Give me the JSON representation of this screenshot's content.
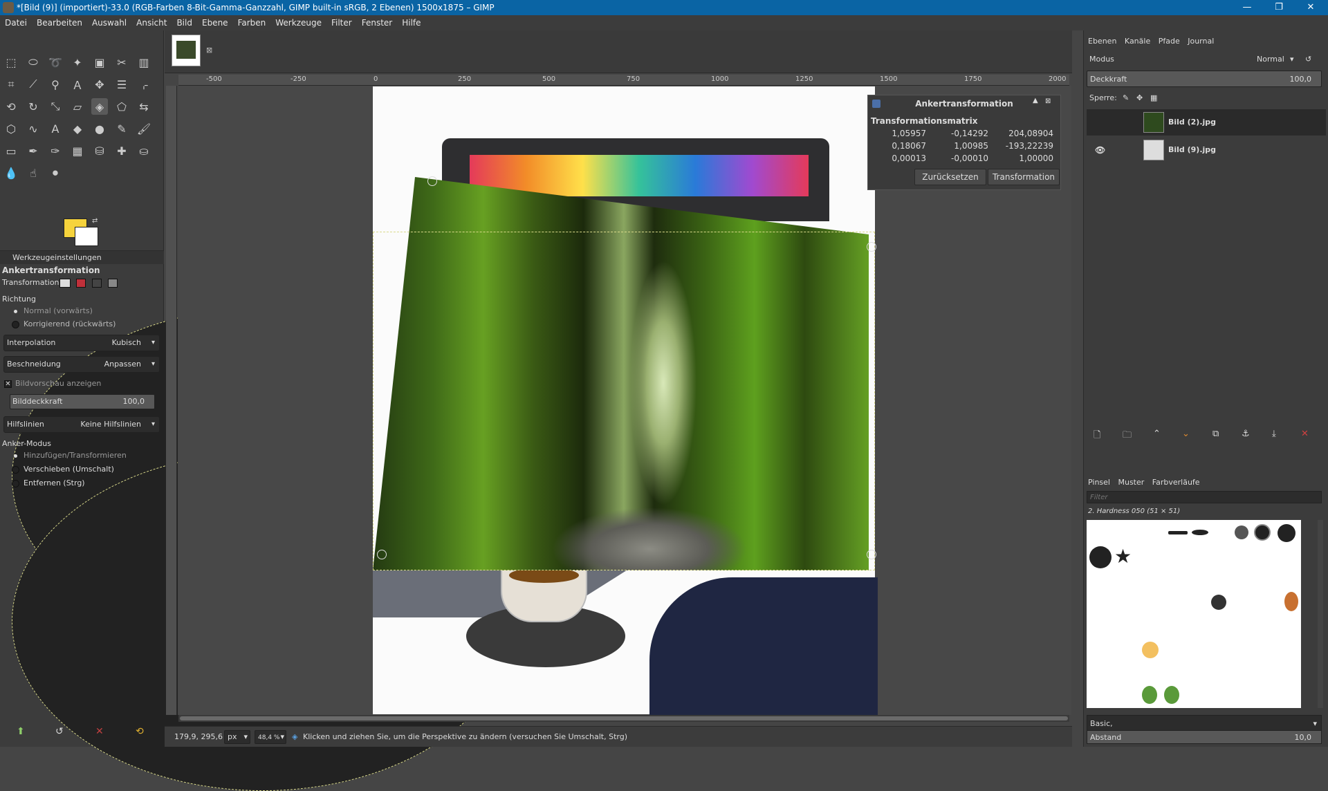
{
  "window": {
    "title": "*[Bild (9)] (importiert)-33.0 (RGB-Farben 8-Bit-Gamma-Ganzzahl, GIMP built-in sRGB, 2 Ebenen) 1500x1875 – GIMP",
    "minimize": "—",
    "maximize": "❐",
    "close": "✕"
  },
  "menu": [
    "Datei",
    "Bearbeiten",
    "Auswahl",
    "Ansicht",
    "Bild",
    "Ebene",
    "Farben",
    "Werkzeuge",
    "Filter",
    "Fenster",
    "Hilfe"
  ],
  "tool_options": {
    "dock_title": "Werkzeugeinstellungen",
    "tool_name": "Ankertransformation",
    "transformation_label": "Transformation:",
    "direction_label": "Richtung",
    "direction_normal": "Normal (vorwärts)",
    "direction_corrective": "Korrigierend (rückwärts)",
    "interpolation_label": "Interpolation",
    "interpolation_value": "Kubisch",
    "clipping_label": "Beschneidung",
    "clipping_value": "Anpassen",
    "preview_label": "Bildvorschau anzeigen",
    "opacity_label": "Bilddeckkraft",
    "opacity_value": "100,0",
    "guides_label": "Hilfslinien",
    "guides_value": "Keine Hilfslinien",
    "anchor_mode_label": "Anker-Modus",
    "anchor_add": "Hinzufügen/Transformieren",
    "anchor_move": "Verschieben (Umschalt)",
    "anchor_remove": "Entfernen (Strg)"
  },
  "ruler": [
    "-500",
    "-250",
    "0",
    "250",
    "500",
    "750",
    "1000",
    "1250",
    "1500",
    "1750",
    "2000"
  ],
  "dialog": {
    "title": "Ankertransformation",
    "matrix_label": "Transformationsmatrix",
    "matrix": [
      [
        "1,05957",
        "-0,14292",
        "204,08904"
      ],
      [
        "0,18067",
        "1,00985",
        "-193,22239"
      ],
      [
        "0,00013",
        "-0,00010",
        "1,00000"
      ]
    ],
    "reset_button": "Zurücksetzen",
    "transform_button": "Transformation"
  },
  "statusbar": {
    "coords": "179,9, 295,6",
    "unit": "px",
    "zoom": "48,4 %",
    "message": "Klicken und ziehen Sie, um die Perspektive zu ändern (versuchen Sie Umschalt, Strg)"
  },
  "layers_panel": {
    "tabs": [
      "Ebenen",
      "Kanäle",
      "Pfade",
      "Journal"
    ],
    "mode_label": "Modus",
    "mode_value": "Normal",
    "opacity_label": "Deckkraft",
    "opacity_value": "100,0",
    "lock_label": "Sperre:",
    "layers": [
      {
        "name": "Bild (2).jpg",
        "visible": false,
        "selected": true
      },
      {
        "name": "Bild (9).jpg",
        "visible": true,
        "selected": false
      }
    ]
  },
  "brushes_panel": {
    "tabs": [
      "Pinsel",
      "Muster",
      "Farbverläufe"
    ],
    "filter_placeholder": "Filter",
    "selected_brush": "2. Hardness 050 (51 × 51)",
    "preset": "Basic,",
    "spacing_label": "Abstand",
    "spacing_value": "10,0"
  },
  "colors": {
    "foreground": "#f6d33c",
    "background": "#ffffff",
    "titlebar": "#0a64a4"
  }
}
